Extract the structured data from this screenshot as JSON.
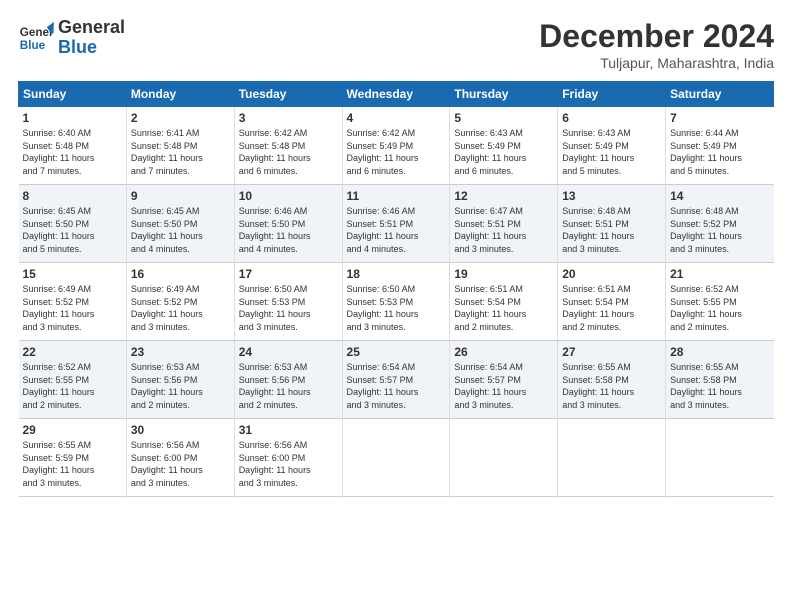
{
  "header": {
    "logo_line1": "General",
    "logo_line2": "Blue",
    "month": "December 2024",
    "location": "Tuljapur, Maharashtra, India"
  },
  "days_of_week": [
    "Sunday",
    "Monday",
    "Tuesday",
    "Wednesday",
    "Thursday",
    "Friday",
    "Saturday"
  ],
  "weeks": [
    [
      {
        "day": "1",
        "info": "Sunrise: 6:40 AM\nSunset: 5:48 PM\nDaylight: 11 hours\nand 7 minutes."
      },
      {
        "day": "2",
        "info": "Sunrise: 6:41 AM\nSunset: 5:48 PM\nDaylight: 11 hours\nand 7 minutes."
      },
      {
        "day": "3",
        "info": "Sunrise: 6:42 AM\nSunset: 5:48 PM\nDaylight: 11 hours\nand 6 minutes."
      },
      {
        "day": "4",
        "info": "Sunrise: 6:42 AM\nSunset: 5:49 PM\nDaylight: 11 hours\nand 6 minutes."
      },
      {
        "day": "5",
        "info": "Sunrise: 6:43 AM\nSunset: 5:49 PM\nDaylight: 11 hours\nand 6 minutes."
      },
      {
        "day": "6",
        "info": "Sunrise: 6:43 AM\nSunset: 5:49 PM\nDaylight: 11 hours\nand 5 minutes."
      },
      {
        "day": "7",
        "info": "Sunrise: 6:44 AM\nSunset: 5:49 PM\nDaylight: 11 hours\nand 5 minutes."
      }
    ],
    [
      {
        "day": "8",
        "info": "Sunrise: 6:45 AM\nSunset: 5:50 PM\nDaylight: 11 hours\nand 5 minutes."
      },
      {
        "day": "9",
        "info": "Sunrise: 6:45 AM\nSunset: 5:50 PM\nDaylight: 11 hours\nand 4 minutes."
      },
      {
        "day": "10",
        "info": "Sunrise: 6:46 AM\nSunset: 5:50 PM\nDaylight: 11 hours\nand 4 minutes."
      },
      {
        "day": "11",
        "info": "Sunrise: 6:46 AM\nSunset: 5:51 PM\nDaylight: 11 hours\nand 4 minutes."
      },
      {
        "day": "12",
        "info": "Sunrise: 6:47 AM\nSunset: 5:51 PM\nDaylight: 11 hours\nand 3 minutes."
      },
      {
        "day": "13",
        "info": "Sunrise: 6:48 AM\nSunset: 5:51 PM\nDaylight: 11 hours\nand 3 minutes."
      },
      {
        "day": "14",
        "info": "Sunrise: 6:48 AM\nSunset: 5:52 PM\nDaylight: 11 hours\nand 3 minutes."
      }
    ],
    [
      {
        "day": "15",
        "info": "Sunrise: 6:49 AM\nSunset: 5:52 PM\nDaylight: 11 hours\nand 3 minutes."
      },
      {
        "day": "16",
        "info": "Sunrise: 6:49 AM\nSunset: 5:52 PM\nDaylight: 11 hours\nand 3 minutes."
      },
      {
        "day": "17",
        "info": "Sunrise: 6:50 AM\nSunset: 5:53 PM\nDaylight: 11 hours\nand 3 minutes."
      },
      {
        "day": "18",
        "info": "Sunrise: 6:50 AM\nSunset: 5:53 PM\nDaylight: 11 hours\nand 3 minutes."
      },
      {
        "day": "19",
        "info": "Sunrise: 6:51 AM\nSunset: 5:54 PM\nDaylight: 11 hours\nand 2 minutes."
      },
      {
        "day": "20",
        "info": "Sunrise: 6:51 AM\nSunset: 5:54 PM\nDaylight: 11 hours\nand 2 minutes."
      },
      {
        "day": "21",
        "info": "Sunrise: 6:52 AM\nSunset: 5:55 PM\nDaylight: 11 hours\nand 2 minutes."
      }
    ],
    [
      {
        "day": "22",
        "info": "Sunrise: 6:52 AM\nSunset: 5:55 PM\nDaylight: 11 hours\nand 2 minutes."
      },
      {
        "day": "23",
        "info": "Sunrise: 6:53 AM\nSunset: 5:56 PM\nDaylight: 11 hours\nand 2 minutes."
      },
      {
        "day": "24",
        "info": "Sunrise: 6:53 AM\nSunset: 5:56 PM\nDaylight: 11 hours\nand 2 minutes."
      },
      {
        "day": "25",
        "info": "Sunrise: 6:54 AM\nSunset: 5:57 PM\nDaylight: 11 hours\nand 3 minutes."
      },
      {
        "day": "26",
        "info": "Sunrise: 6:54 AM\nSunset: 5:57 PM\nDaylight: 11 hours\nand 3 minutes."
      },
      {
        "day": "27",
        "info": "Sunrise: 6:55 AM\nSunset: 5:58 PM\nDaylight: 11 hours\nand 3 minutes."
      },
      {
        "day": "28",
        "info": "Sunrise: 6:55 AM\nSunset: 5:58 PM\nDaylight: 11 hours\nand 3 minutes."
      }
    ],
    [
      {
        "day": "29",
        "info": "Sunrise: 6:55 AM\nSunset: 5:59 PM\nDaylight: 11 hours\nand 3 minutes."
      },
      {
        "day": "30",
        "info": "Sunrise: 6:56 AM\nSunset: 6:00 PM\nDaylight: 11 hours\nand 3 minutes."
      },
      {
        "day": "31",
        "info": "Sunrise: 6:56 AM\nSunset: 6:00 PM\nDaylight: 11 hours\nand 3 minutes."
      },
      {
        "day": "",
        "info": ""
      },
      {
        "day": "",
        "info": ""
      },
      {
        "day": "",
        "info": ""
      },
      {
        "day": "",
        "info": ""
      }
    ]
  ]
}
